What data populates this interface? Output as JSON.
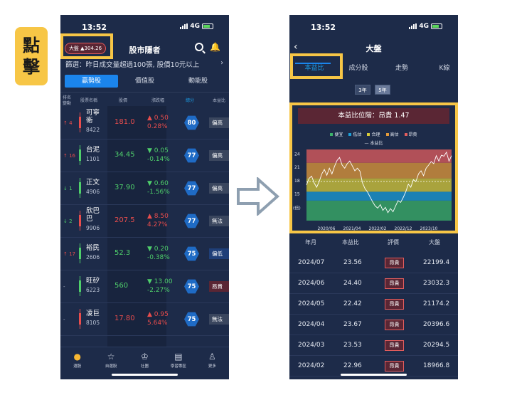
{
  "side_tag": {
    "line1": "點",
    "line2": "擊"
  },
  "phone1": {
    "time": "13:52",
    "network": "4G",
    "index_badge": "大盤 ▲304.26",
    "title": "股市隱者",
    "filter_text": "篩選：昨日成交量超過100張, 股價10元以上",
    "filter_chevron": "›",
    "tabs": [
      "贏勢股",
      "價值股",
      "動能股"
    ],
    "columns": {
      "rank": "排名",
      "rank2": "變動",
      "name": "股票名稱",
      "price": "股價",
      "change": "漲跌幅",
      "score": "總分",
      "pe": "本益比"
    },
    "rows": [
      {
        "rank": "↑ 4",
        "name": "可寧衛",
        "code": "8422",
        "price": "181.0",
        "chg1": "▲ 0.50",
        "chg2": "0.28%",
        "score": "80",
        "eval": "偏高"
      },
      {
        "rank": "↑ 16",
        "name": "台泥",
        "code": "1101",
        "price": "34.45",
        "chg1": "▼ 0.05",
        "chg2": "-0.14%",
        "score": "77",
        "eval": "偏高"
      },
      {
        "rank": "↓ 1",
        "name": "正文",
        "code": "4906",
        "price": "37.90",
        "chg1": "▼ 0.60",
        "chg2": "-1.56%",
        "score": "77",
        "eval": "偏高"
      },
      {
        "rank": "↓ 2",
        "name": "欣巴巴",
        "code": "9906",
        "price": "207.5",
        "chg1": "▲ 8.50",
        "chg2": "4.27%",
        "score": "77",
        "eval": "無法"
      },
      {
        "rank": "↑ 17",
        "name": "裕民",
        "code": "2606",
        "price": "52.3",
        "chg1": "▼ 0.20",
        "chg2": "-0.38%",
        "score": "75",
        "eval": "偏低"
      },
      {
        "rank": "-",
        "name": "旺矽",
        "code": "6223",
        "price": "560",
        "chg1": "▼ 13.00",
        "chg2": "-2.27%",
        "score": "75",
        "eval": "昂貴"
      },
      {
        "rank": "-",
        "name": "凌巨",
        "code": "8105",
        "price": "17.80",
        "chg1": "▲ 0.95",
        "chg2": "5.64%",
        "score": "75",
        "eval": "無法"
      }
    ],
    "nav": [
      "選股",
      "自選股",
      "社團",
      "學習專區",
      "更多"
    ]
  },
  "phone2": {
    "time": "13:52",
    "network": "4G",
    "back": "‹",
    "title": "大盤",
    "tabs": [
      "本益比",
      "成分股",
      "走勢",
      "K線"
    ],
    "years": [
      "3年",
      "5年"
    ],
    "chart_title": "本益比位階：昂貴 1.47",
    "legend": [
      {
        "label": "便宜",
        "color": "#3bb36a"
      },
      {
        "label": "低估",
        "color": "#1b9fd8"
      },
      {
        "label": "合理",
        "color": "#d8cc3a"
      },
      {
        "label": "高估",
        "color": "#e39a3a"
      },
      {
        "label": "昂貴",
        "color": "#e35d5d"
      }
    ],
    "legend_line": "— 本益比",
    "table_head": [
      "年月",
      "本益比",
      "評價",
      "大盤"
    ],
    "table_rows": [
      {
        "ym": "2024/07",
        "pe": "23.56",
        "eval": "昂貴",
        "idx": "22199.4"
      },
      {
        "ym": "2024/06",
        "pe": "24.40",
        "eval": "昂貴",
        "idx": "23032.3"
      },
      {
        "ym": "2024/05",
        "pe": "22.42",
        "eval": "昂貴",
        "idx": "21174.2"
      },
      {
        "ym": "2024/04",
        "pe": "23.67",
        "eval": "昂貴",
        "idx": "20396.6"
      },
      {
        "ym": "2024/03",
        "pe": "23.53",
        "eval": "昂貴",
        "idx": "20294.5"
      },
      {
        "ym": "2024/02",
        "pe": "22.96",
        "eval": "昂貴",
        "idx": "18966.8"
      }
    ]
  },
  "chart_data": {
    "type": "line",
    "title": "本益比位階：昂貴 1.47",
    "ylabel": "(倍)",
    "yticks": [
      "24",
      "21",
      "18",
      "15"
    ],
    "ylim": [
      9,
      25
    ],
    "xticks": [
      "2020/06",
      "2021/04",
      "2022/02",
      "2022/12",
      "2023/10"
    ],
    "bands": [
      {
        "name": "便宜",
        "from": 9,
        "to": 13.5,
        "color": "#3bb36a"
      },
      {
        "name": "低估",
        "from": 13.5,
        "to": 15.5,
        "color": "#1b9fd8"
      },
      {
        "name": "合理",
        "from": 15.5,
        "to": 18.5,
        "color": "#d8cc3a"
      },
      {
        "name": "高估",
        "from": 18.5,
        "to": 22,
        "color": "#e39a3a"
      },
      {
        "name": "昂貴",
        "from": 22,
        "to": 25,
        "color": "#e35d5d"
      }
    ],
    "mean_line": 17.8,
    "series": [
      {
        "name": "本益比",
        "values": [
          17,
          18.5,
          19,
          17.5,
          16.5,
          17.8,
          19.5,
          20.5,
          19.2,
          20.8,
          19.5,
          21.2,
          22.5,
          23.2,
          21.5,
          20.8,
          21.8,
          22.4,
          21.3,
          20.2,
          20.8,
          20.1,
          17.5,
          16.2,
          15.4,
          14.3,
          13.2,
          12.3,
          11.8,
          12.6,
          11.3,
          12.0,
          10.8,
          11.7,
          11.0,
          12.3,
          13.5,
          13.1,
          14.2,
          15.5,
          17.2,
          16.5,
          18.2,
          17.8,
          19.5,
          20.2,
          19.1,
          20.8,
          21.5,
          22.3,
          21.8,
          23.6,
          22.4,
          23.7,
          23.5,
          24.4,
          22.4,
          23.6
        ]
      }
    ]
  }
}
